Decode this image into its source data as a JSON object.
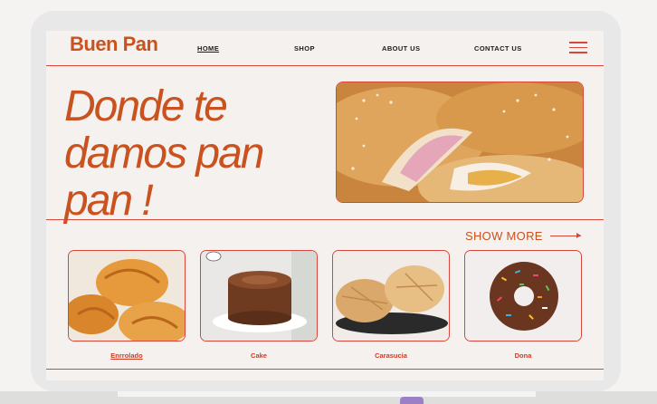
{
  "brand": {
    "logo": "Buen Pan",
    "accent": "#c9521f",
    "line": "#d8453a"
  },
  "nav": [
    {
      "label": "HOME",
      "active": true
    },
    {
      "label": "SHOP"
    },
    {
      "label": "ABOUT US"
    },
    {
      "label": "CONTACT US"
    }
  ],
  "icons": {
    "menu": "hamburger-menu-icon",
    "arrow": "arrow-right-icon"
  },
  "hero": {
    "line1": "Donde te",
    "line2": "damos pan",
    "line3": "pan !"
  },
  "show_more": "SHOW MORE",
  "products": [
    {
      "name": "Enrrolado"
    },
    {
      "name": "Cake"
    },
    {
      "name": "Carasucia"
    },
    {
      "name": "Dona"
    }
  ]
}
